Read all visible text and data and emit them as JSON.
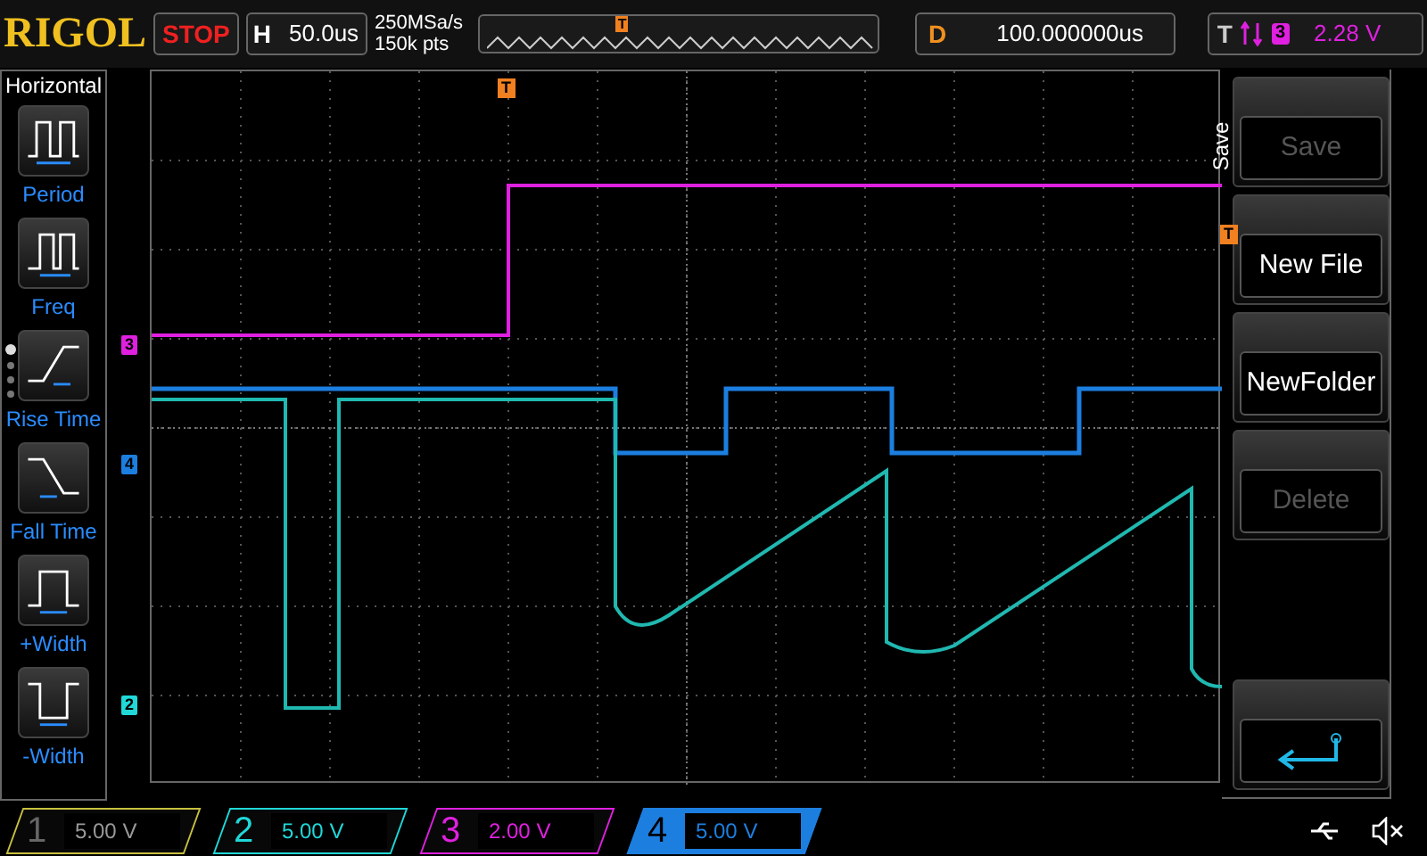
{
  "top_bar": {
    "brand": "RIGOL",
    "run_state": "STOP",
    "horizontal": {
      "label": "H",
      "value": "50.0us"
    },
    "sample_rate": "250MSa/s",
    "memory_depth": "150k pts",
    "trigger_marker": "T",
    "delay": {
      "label": "D",
      "value": "100.000000us"
    },
    "trigger": {
      "label": "T",
      "source": "3",
      "level": "2.28 V"
    }
  },
  "left_menu": {
    "title": "Horizontal",
    "items": [
      {
        "label": "Period",
        "kind": "period"
      },
      {
        "label": "Freq",
        "kind": "freq"
      },
      {
        "label": "Rise Time",
        "kind": "rise"
      },
      {
        "label": "Fall Time",
        "kind": "fall"
      },
      {
        "label": "+Width",
        "kind": "pwidth"
      },
      {
        "label": "-Width",
        "kind": "nwidth"
      }
    ],
    "pages": [
      {
        "selected": true
      },
      {
        "selected": false
      },
      {
        "selected": false
      },
      {
        "selected": false
      }
    ]
  },
  "grid": {
    "trigger_position": "T",
    "trigger_level": "T",
    "channel_markers": [
      {
        "label": "3",
        "color": "#e020e0"
      },
      {
        "label": "4",
        "color": "#1c7fe0"
      },
      {
        "label": "2",
        "color": "#20d8d8"
      }
    ]
  },
  "right_menu": {
    "title": "Save",
    "buttons": [
      {
        "kind": "text",
        "label": "Save",
        "disabled": true
      },
      {
        "kind": "text",
        "label": "New File",
        "disabled": false
      },
      {
        "kind": "text",
        "label": "NewFolder",
        "disabled": false
      },
      {
        "kind": "text",
        "label": "Delete",
        "disabled": true
      },
      {
        "kind": "back",
        "disabled": false
      }
    ]
  },
  "channels": [
    {
      "number": "1",
      "scale": "5.00 V",
      "enabled": false,
      "selected": false,
      "color": "#c8c040"
    },
    {
      "number": "2",
      "scale": "5.00 V",
      "enabled": true,
      "selected": false,
      "color": "#20d8d8"
    },
    {
      "number": "3",
      "scale": "2.00 V",
      "enabled": true,
      "selected": false,
      "color": "#e020e0"
    },
    {
      "number": "4",
      "scale": "5.00 V",
      "enabled": true,
      "selected": true,
      "color": "#1c7fe0"
    }
  ]
}
